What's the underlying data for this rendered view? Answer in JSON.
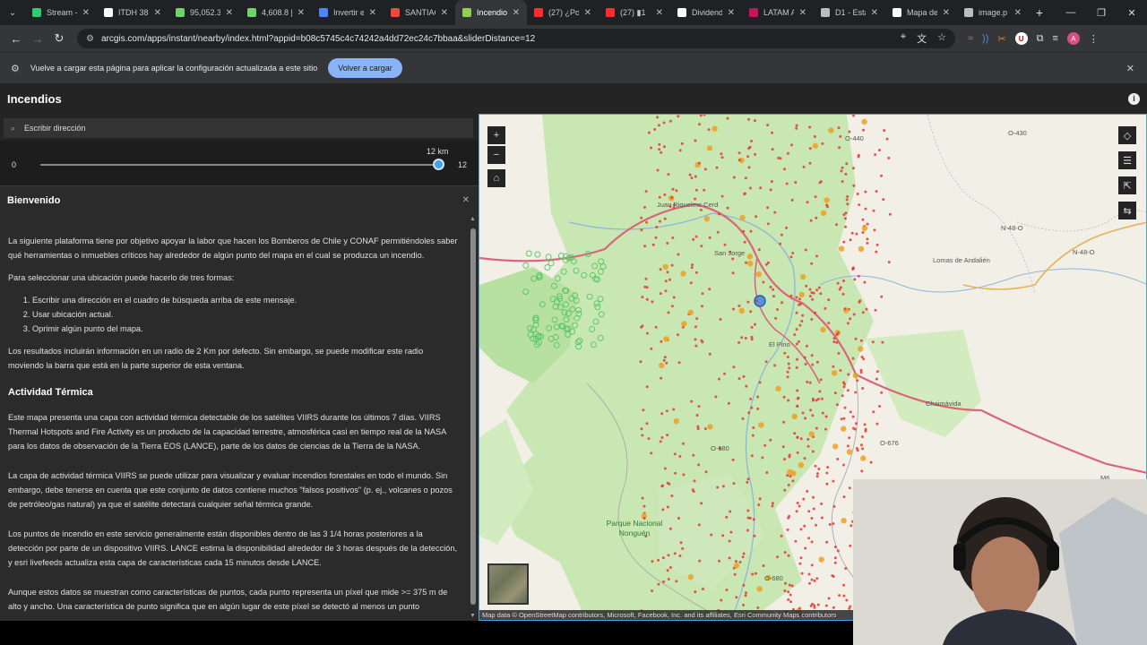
{
  "browser": {
    "tabs": [
      {
        "label": "Stream -",
        "color": "#2ecc71",
        "active": false
      },
      {
        "label": "ITDH 38,",
        "color": "#ffffff",
        "active": false
      },
      {
        "label": "95,052.3",
        "color": "#6ed36a",
        "active": false
      },
      {
        "label": "4,608.8 |",
        "color": "#6ed36a",
        "active": false
      },
      {
        "label": "Invertir e",
        "color": "#4f86f7",
        "active": false
      },
      {
        "label": "SANTIAG",
        "color": "#e74c3c",
        "active": false
      },
      {
        "label": "Incendio",
        "color": "#8fd14f",
        "active": true
      },
      {
        "label": "(27) ¿Por",
        "color": "#ff2d2d",
        "active": false
      },
      {
        "label": "(27) ▮1",
        "color": "#ff2d2d",
        "active": false
      },
      {
        "label": "Dividend",
        "color": "#ffffff",
        "active": false
      },
      {
        "label": "LATAM A",
        "color": "#c2185b",
        "active": false
      },
      {
        "label": "D1 - Esta",
        "color": "#bdbdbd",
        "active": false
      },
      {
        "label": "Mapa de",
        "color": "#ffffff",
        "active": false
      },
      {
        "label": "image.p",
        "color": "#bdbdbd",
        "active": false
      }
    ],
    "url": "arcgis.com/apps/instant/nearby/index.html?appid=b08c5745c4c74242a4dd72ec24c7bbaa&sliderDistance=12",
    "profile_initial": "A",
    "info_message": "Vuelve a cargar esta página para aplicar la configuración actualizada a este sitio",
    "reload_label": "Volver a cargar"
  },
  "app": {
    "title": "Incendios",
    "search_placeholder": "Escribir dirección",
    "slider": {
      "min": "0",
      "max": "12",
      "current_label": "12 km",
      "value": 12,
      "range_max": 12
    },
    "welcome_title": "Bienvenido",
    "intro": "La siguiente plataforma tiene por objetivo apoyar la labor que hacen los Bomberos de Chile y CONAF permitiéndoles saber qué herramientas o inmuebles críticos hay alrededor de algún punto del mapa en el cual se produzca un incendio.",
    "select_intro": "Para seleccionar una ubicación puede hacerlo de tres formas:",
    "steps": [
      "Escribir una dirección en el cuadro de búsqueda arriba de este mensaje.",
      "Usar ubicación actual.",
      "Oprimir algún punto del mapa."
    ],
    "radius_note": "Los resultados incluirán información en un radio de 2 Km por defecto. Sin embargo, se puede modificar este radio moviendo la barra que está en la parte superior de esta ventana.",
    "section_title": "Actividad Térmica",
    "para1": "Este mapa presenta una capa con actividad térmica detectable de los satélites VIIRS durante los últimos 7 días. VIIRS Thermal Hotspots and Fire Activity es un producto de la capacidad terrestre, atmosférica casi en tiempo real de la NASA para los datos de observación de la Tierra EOS (LANCE), parte de los datos de ciencias de la Tierra de la NASA.",
    "para2": "La capa de actividad térmica VIIRS se puede utilizar para visualizar y evaluar incendios forestales en todo el mundo. Sin embargo, debe tenerse en cuenta que este conjunto de datos contiene muchos \"falsos positivos\" (p. ej., volcanes o pozos de petróleo/gas natural) ya que el satélite detectará cualquier señal térmica grande.",
    "para3": "Los puntos de incendio en este servicio generalmente están disponibles dentro de las 3 1/4 horas posteriores a la detección por parte de un dispositivo VIIRS. LANCE estima la disponibilidad alrededor de 3 horas después de la detección, y esri livefeeds actualiza esta capa de características cada 15 minutos desde LANCE.",
    "para4": "Aunque estos datos se muestran como características de puntos, cada punto representa un píxel que mide >= 375 m de alto y ancho. Una característica de punto significa que en algún lugar de este píxel se detectó al menos un punto"
  },
  "map": {
    "labels": {
      "o440": "O-440",
      "o430": "O-430",
      "n48o": "N-48-O",
      "n48o2": "N-48-O",
      "lomas": "Lomas de Andalién",
      "juan": "Juan Riquelme Cerd",
      "sanjorge": "San Jorge",
      "elpino": "El Pino",
      "chaimavida": "Chaimávida",
      "o680": "O-680",
      "o676": "O-676",
      "o680b": "O-680",
      "park": "Parque Nacional Nonguén",
      "m6": "M6"
    },
    "attribution": "Map data © OpenStreetMap contributors, Microsoft, Facebook, Inc. and its affiliates, Esri Community Maps contributors"
  },
  "colors": {
    "accent": "#47a0e6",
    "fire": "#e53935",
    "forest": "#c9e7b3",
    "road": "#d9667a"
  }
}
